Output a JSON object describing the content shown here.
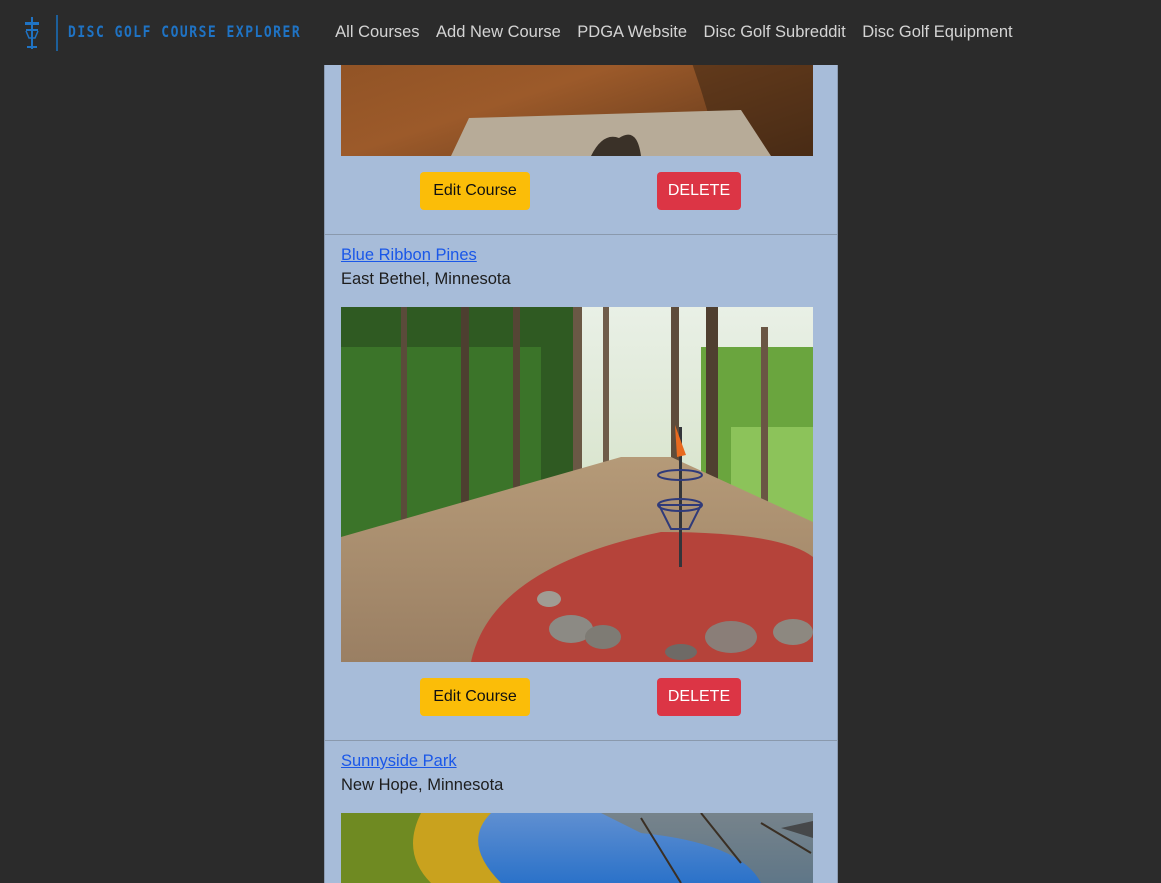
{
  "brand": {
    "title": "DISC GOLF COURSE EXPLORER"
  },
  "nav": {
    "links": [
      "All Courses",
      "Add New Course",
      "PDGA Website",
      "Disc Golf Subreddit",
      "Disc Golf Equipment"
    ]
  },
  "courses": [
    {
      "name": "",
      "location": "",
      "edit_label": "Edit Course",
      "delete_label": "DELETE"
    },
    {
      "name": "Blue Ribbon Pines",
      "location": "East Bethel, Minnesota",
      "edit_label": "Edit Course",
      "delete_label": "DELETE"
    },
    {
      "name": "Sunnyside Park",
      "location": "New Hope, Minnesota"
    }
  ],
  "colors": {
    "page_bg": "#2b2b2b",
    "panel_bg": "#a7bcd9",
    "brand": "#1f73c4",
    "link": "#1a57e8",
    "edit_button": "#fbbd08",
    "delete_button": "#dc3545"
  }
}
